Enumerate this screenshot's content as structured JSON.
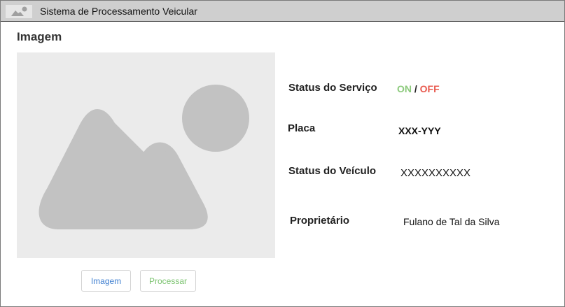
{
  "window": {
    "title": "Sistema de Processamento Veicular"
  },
  "section": {
    "title": "Imagem"
  },
  "image": {
    "icon": "image-placeholder-icon"
  },
  "buttons": {
    "image_label": "Imagem",
    "process_label": "Processar"
  },
  "fields": {
    "service_status": {
      "label": "Status do Serviço",
      "on": "ON",
      "separator": "/",
      "off": "OFF"
    },
    "plate": {
      "label": "Placa",
      "value": "XXX-YYY"
    },
    "vehicle_status": {
      "label": "Status do Veículo",
      "value": "XXXXXXXXXX"
    },
    "owner": {
      "label": "Proprietário",
      "value": "Fulano de Tal da Silva"
    }
  },
  "colors": {
    "on": "#8cca7c",
    "off": "#e85a4f",
    "image_button": "#3f7fd0",
    "process_button": "#7bc36f",
    "titlebar": "#cfcfcf",
    "placeholder": "#ebebeb"
  }
}
